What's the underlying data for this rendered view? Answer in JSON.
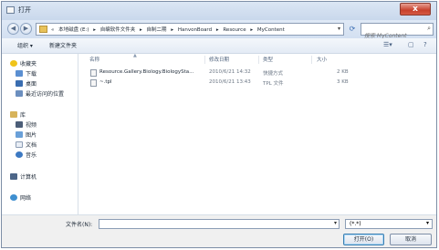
{
  "window": {
    "title": "打开",
    "close_glyph": "x"
  },
  "nav": {
    "back_glyph": "◀",
    "forward_glyph": "▶",
    "breadcrumbs": [
      "«",
      "本地磁盘 (E:)",
      "▸",
      "自编软件文件夹",
      "▸",
      "自制二期",
      "▸",
      "HanvonBoard",
      "▸",
      "Resource",
      "▸",
      "MyContent"
    ],
    "refresh_glyph": "⟳",
    "search_placeholder": "搜索 MyContent"
  },
  "toolbar": {
    "organize": "组织 ▾",
    "new_folder": "新建文件夹"
  },
  "sidebar": {
    "favorites": "收藏夹",
    "items1": [
      "下载",
      "桌面",
      "最近访问的位置"
    ],
    "libraries": "库",
    "items2": [
      "视频",
      "图片",
      "文档",
      "音乐"
    ],
    "computer": "计算机",
    "network": "网络"
  },
  "columns": {
    "name": "名称",
    "date": "修改日期",
    "type": "类型",
    "size": "大小"
  },
  "files": [
    {
      "name": "Resource.Gallery.Biology.BiologySta...",
      "date": "2010/6/21 14:32",
      "type": "快捷方式",
      "size": "2 KB"
    },
    {
      "name": "~.tpl",
      "date": "2010/6/21 13:43",
      "type": "TPL 文件",
      "size": "3 KB"
    }
  ],
  "bottom": {
    "filename_label": "文件名(N):",
    "filename_value": "",
    "filter_value": "(*.*)",
    "open_button": "打开(O)",
    "cancel_button": "取消"
  },
  "colors": {
    "accent": "#3c7fb1",
    "close": "#c7412c"
  }
}
